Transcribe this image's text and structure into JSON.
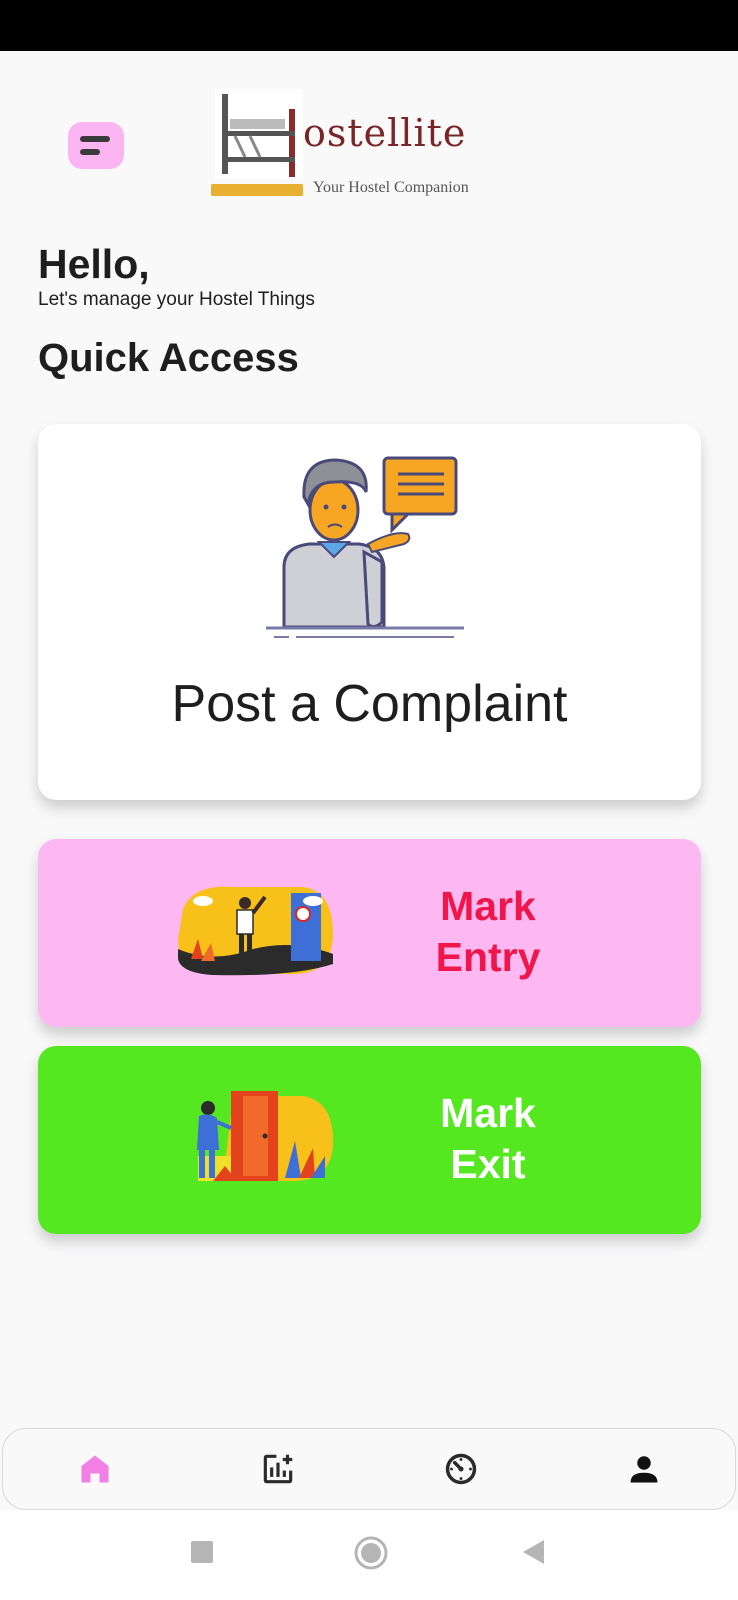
{
  "header": {
    "logo_text": "ostellite",
    "logo_tagline": "Your Hostel Companion"
  },
  "greeting": {
    "title": "Hello,",
    "subtitle": "Let's manage your Hostel Things"
  },
  "section_title": "Quick Access",
  "cards": {
    "complaint_label": "Post a Complaint",
    "entry_label_line1": "Mark",
    "entry_label_line2": "Entry",
    "exit_label_line1": "Mark",
    "exit_label_line2": "Exit"
  },
  "colors": {
    "menu_button": "#fcb5f3",
    "entry_card": "#fdb8f2",
    "entry_text": "#f0164b",
    "exit_card": "#55e821",
    "exit_text": "#ffffff",
    "nav_active": "#f07fe6",
    "logo_text": "#7a2628"
  },
  "bottom_nav": [
    {
      "icon": "home-icon",
      "active": true
    },
    {
      "icon": "add-chart-icon",
      "active": false
    },
    {
      "icon": "timer-icon",
      "active": false
    },
    {
      "icon": "person-icon",
      "active": false
    }
  ],
  "system_nav": [
    "recents-icon",
    "home-circle-icon",
    "back-icon"
  ]
}
